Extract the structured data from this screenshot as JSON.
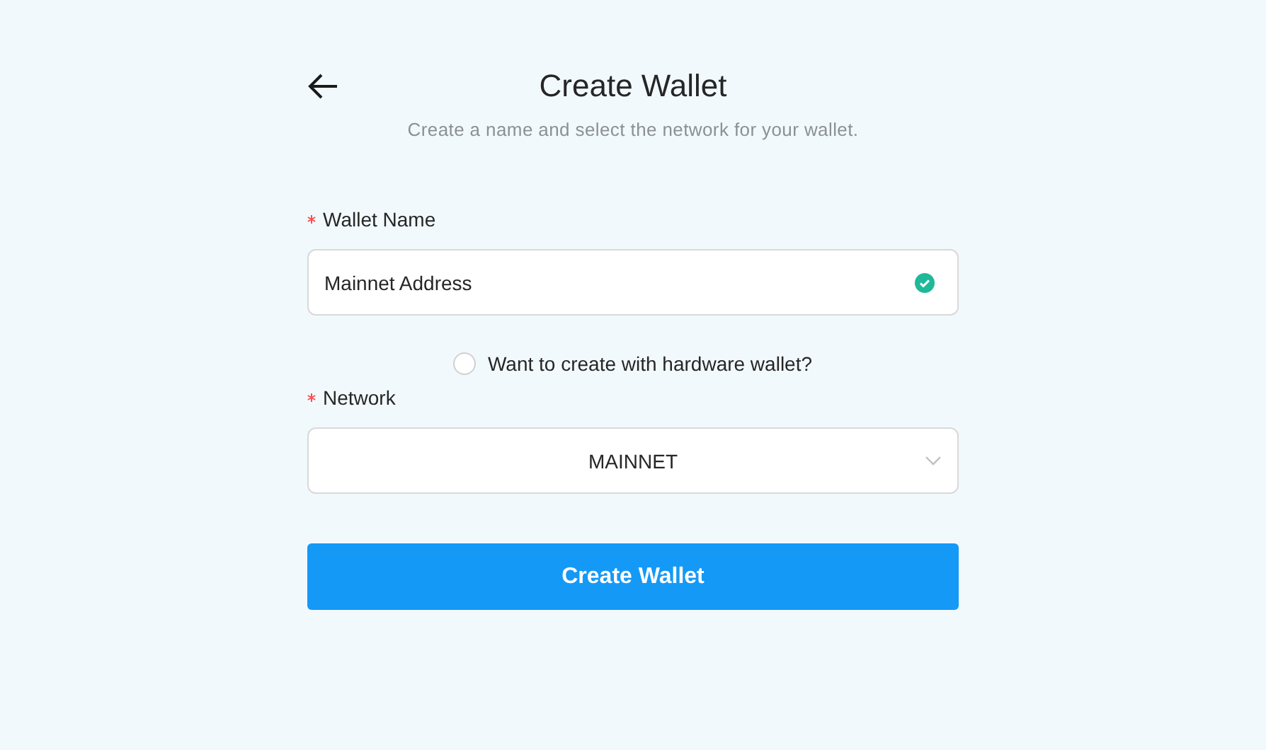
{
  "header": {
    "title": "Create Wallet",
    "subtitle": "Create a name and select the network for your wallet."
  },
  "wallet_name": {
    "label": "Wallet Name",
    "required": true,
    "value": "Mainnet Address",
    "valid": true
  },
  "hardware_option": {
    "label": "Want to create with hardware wallet?",
    "checked": false
  },
  "network": {
    "label": "Network",
    "required": true,
    "value": "MAINNET"
  },
  "submit_button": {
    "label": "Create Wallet"
  }
}
